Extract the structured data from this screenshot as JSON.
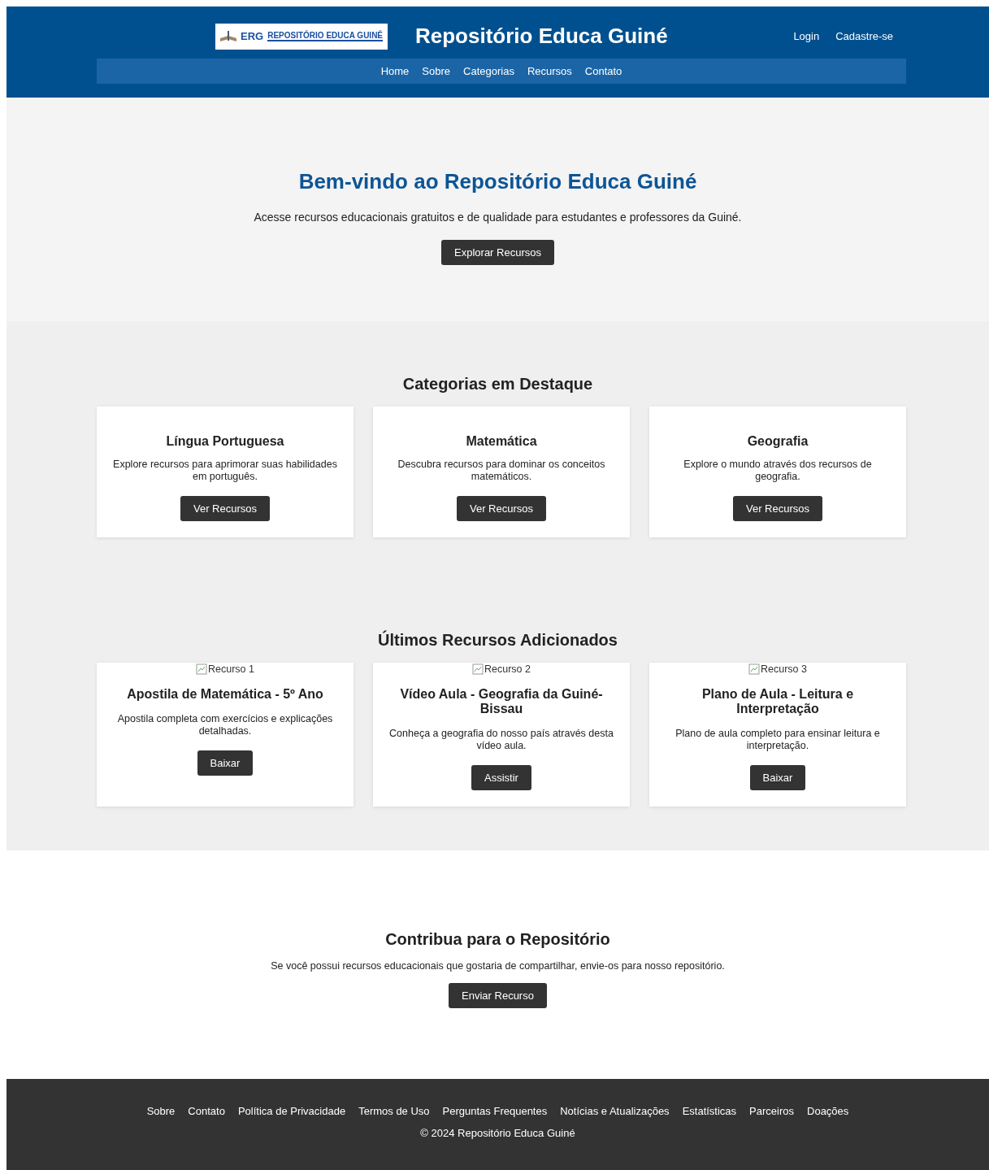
{
  "header": {
    "logo_text": "REPOSITÓRIO EDUCA GUINÉ",
    "logo_mark": "ERG",
    "title": "Repositório Educa Guiné",
    "account_links": [
      "Login",
      "Cadastre-se"
    ],
    "nav": [
      "Home",
      "Sobre",
      "Categorias",
      "Recursos",
      "Contato"
    ]
  },
  "hero": {
    "title": "Bem-vindo ao Repositório Educa Guiné",
    "text": "Acesse recursos educacionais gratuitos e de qualidade para estudantes e professores da Guiné.",
    "button": "Explorar Recursos"
  },
  "categories": {
    "title": "Categorias em Destaque",
    "items": [
      {
        "title": "Língua Portuguesa",
        "text": "Explore recursos para aprimorar suas habilidades em português.",
        "button": "Ver Recursos"
      },
      {
        "title": "Matemática",
        "text": "Descubra recursos para dominar os conceitos matemáticos.",
        "button": "Ver Recursos"
      },
      {
        "title": "Geografia",
        "text": "Explore o mundo através dos recursos de geografia.",
        "button": "Ver Recursos"
      }
    ]
  },
  "latest": {
    "title": "Últimos Recursos Adicionados",
    "items": [
      {
        "image_alt": "Recurso 1",
        "title": "Apostila de Matemática - 5º Ano",
        "text": "Apostila completa com exercícios e explicações detalhadas.",
        "button": "Baixar"
      },
      {
        "image_alt": "Recurso 2",
        "title": "Vídeo Aula - Geografia da Guiné-Bissau",
        "text": "Conheça a geografia do nosso país através desta vídeo aula.",
        "button": "Assistir"
      },
      {
        "image_alt": "Recurso 3",
        "title": "Plano de Aula - Leitura e Interpretação",
        "text": "Plano de aula completo para ensinar leitura e interpretação.",
        "button": "Baixar"
      }
    ]
  },
  "contribute": {
    "title": "Contribua para o Repositório",
    "text": "Se você possui recursos educacionais que gostaria de compartilhar, envie-os para nosso repositório.",
    "button": "Enviar Recurso"
  },
  "footer": {
    "links": [
      "Sobre",
      "Contato",
      "Política de Privacidade",
      "Termos de Uso",
      "Perguntas Frequentes",
      "Notícias e Atualizações",
      "Estatísticas",
      "Parceiros",
      "Doações"
    ],
    "copyright": "© 2024 Repositório Educa Guiné"
  }
}
